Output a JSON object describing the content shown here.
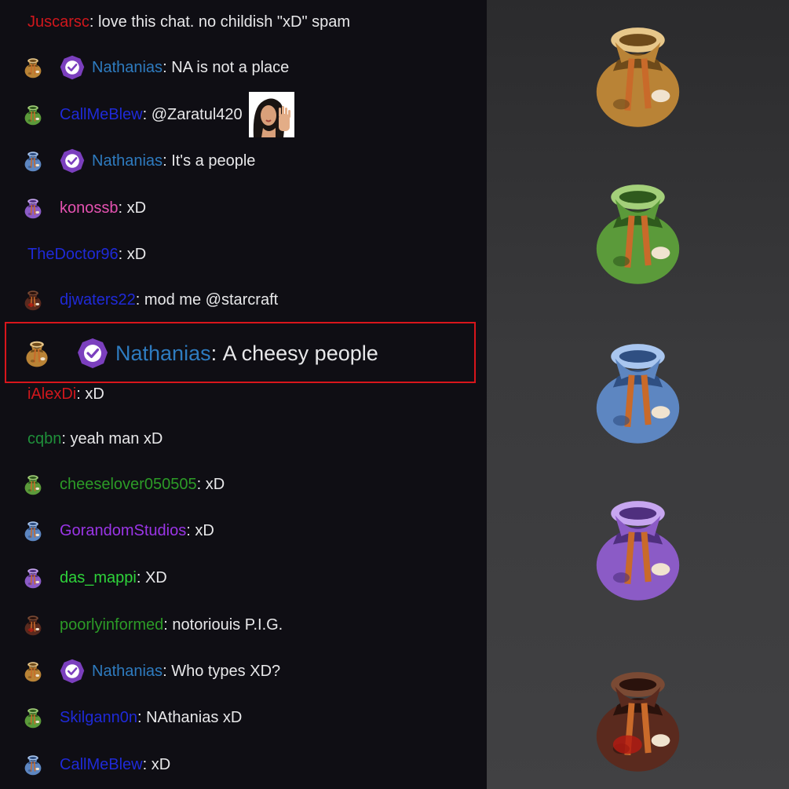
{
  "colors": {
    "chat_bg": "#0f0e14",
    "text": "#e8e8ea",
    "highlight_border": "#d8151b",
    "badge": "#7b3fbe",
    "bag_gold": "#b98336",
    "bag_green": "#5b9a3a",
    "bag_blue": "#5d86c1",
    "bag_purple": "#8b5bc6",
    "bag_red": "#5a2a1e"
  },
  "messages": [
    {
      "user": "Juscarsc",
      "user_color": "#d0171c",
      "text": "love this chat. no childish \"xD\" spam",
      "bag": "none",
      "badge": false
    },
    {
      "user": "Nathanias",
      "user_color": "#2e7bbf",
      "text": "NA is not a place",
      "bag": "gold",
      "badge": true
    },
    {
      "user": "CallMeBlew",
      "user_color": "#1f2ad8",
      "text": "@Zaratul420",
      "bag": "green",
      "badge": false,
      "emote": "waving-woman-emote"
    },
    {
      "user": "Nathanias",
      "user_color": "#2e7bbf",
      "text": "It's a people",
      "bag": "blue",
      "badge": true
    },
    {
      "user": "konossb",
      "user_color": "#e552b1",
      "text": "xD",
      "bag": "purple",
      "badge": false
    },
    {
      "user": "TheDoctor96",
      "user_color": "#1f2ad8",
      "text": "xD",
      "bag": "none",
      "badge": false
    },
    {
      "user": "djwaters22",
      "user_color": "#1f2ad8",
      "text": "mod me @starcraft",
      "bag": "red",
      "badge": false
    },
    {
      "user": "iAlexDi",
      "user_color": "#d0171c",
      "text": "xD",
      "bag": "none",
      "badge": false
    },
    {
      "user": "cqbn",
      "user_color": "#1f8f3a",
      "text": "yeah man xD",
      "bag": "none",
      "badge": false
    },
    {
      "user": "cheeselover050505",
      "user_color": "#2c9b27",
      "text": "xD",
      "bag": "green",
      "badge": false
    },
    {
      "user": "GorandomStudios",
      "user_color": "#9a35e6",
      "text": "xD",
      "bag": "blue",
      "badge": false
    },
    {
      "user": "das_mappi",
      "user_color": "#2ed33a",
      "text": "XD",
      "bag": "purple",
      "badge": false
    },
    {
      "user": "poorlyinformed",
      "user_color": "#2c9b27",
      "text": "notoriouis P.I.G.",
      "bag": "red",
      "badge": false
    },
    {
      "user": "Nathanias",
      "user_color": "#2e7bbf",
      "text": "Who types XD?",
      "bag": "gold",
      "badge": true
    },
    {
      "user": "Skilgann0n",
      "user_color": "#1f2ad8",
      "text": "NAthanias xD",
      "bag": "green",
      "badge": false
    },
    {
      "user": "CallMeBlew",
      "user_color": "#1f2ad8",
      "text": "xD",
      "bag": "blue",
      "badge": false
    }
  ],
  "highlighted": {
    "user": "Nathanias",
    "user_color": "#2e7bbf",
    "text": "A cheesy people",
    "bag": "gold",
    "badge": true
  },
  "showcase": {
    "bags": [
      {
        "name": "gold-bag-icon",
        "tier": "gold"
      },
      {
        "name": "green-bag-icon",
        "tier": "green"
      },
      {
        "name": "blue-bag-icon",
        "tier": "blue"
      },
      {
        "name": "purple-bag-icon",
        "tier": "purple"
      },
      {
        "name": "red-bag-icon",
        "tier": "red"
      }
    ]
  }
}
